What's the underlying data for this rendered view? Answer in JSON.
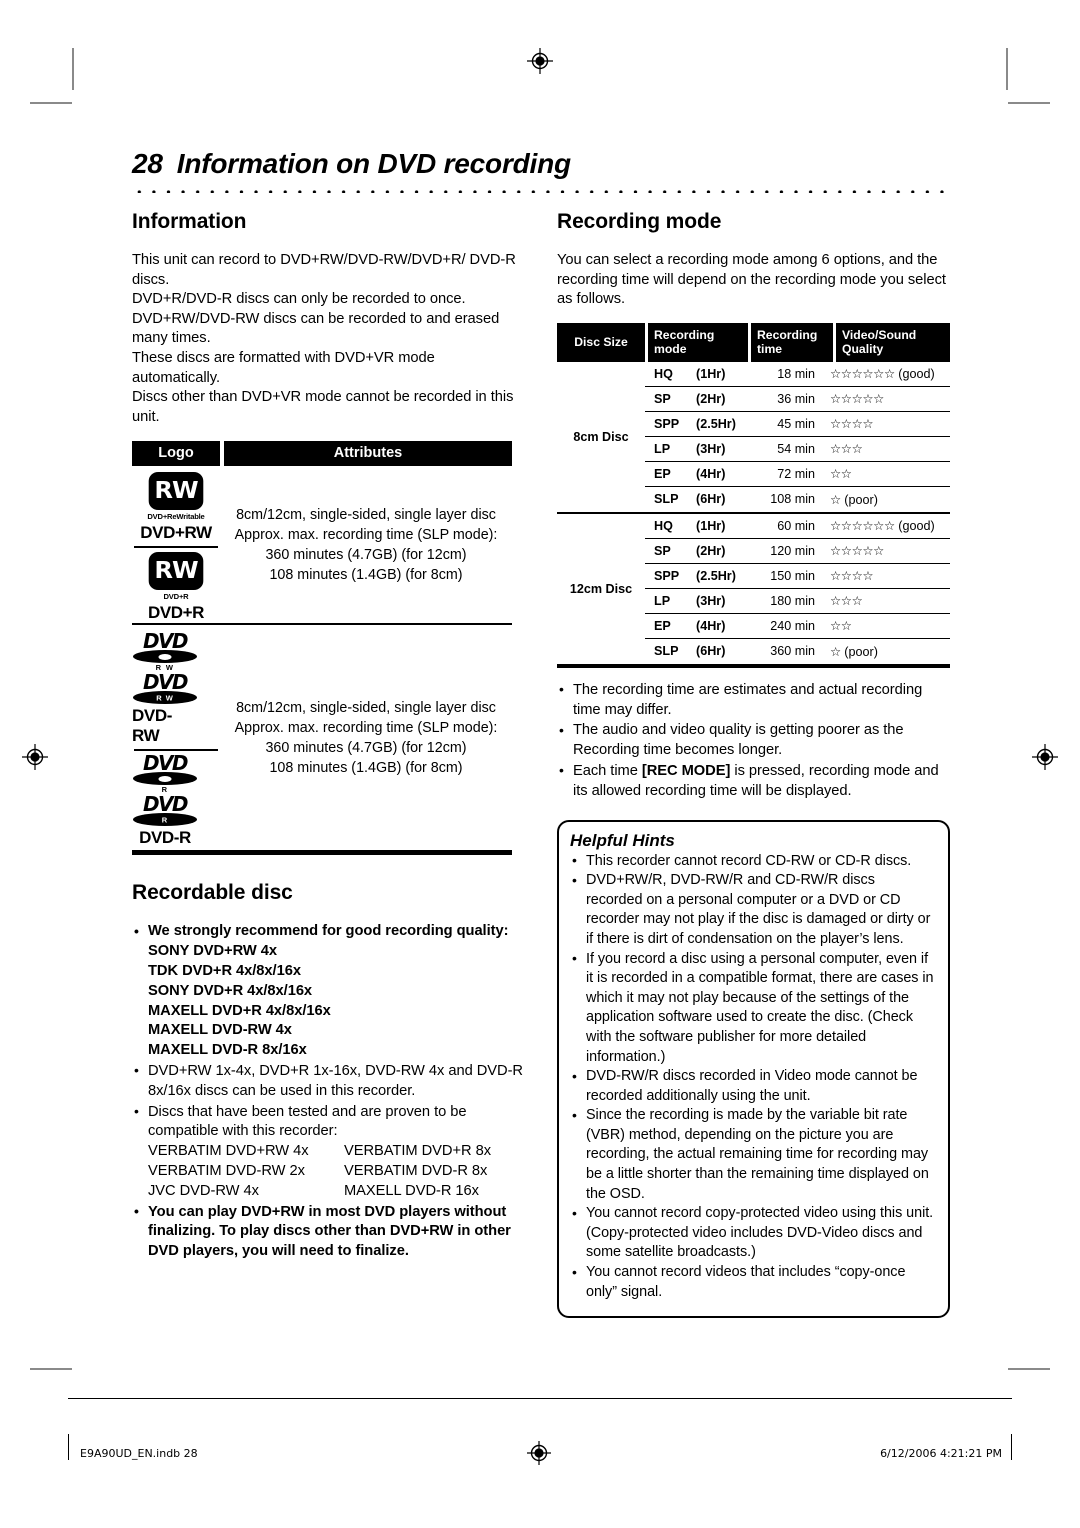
{
  "header": {
    "page_number": "28",
    "title": "Information on DVD recording"
  },
  "left_column": {
    "information": {
      "heading": "Information",
      "paragraph": "This unit can record to DVD+RW/DVD-RW/DVD+R/ DVD-R discs.\nDVD+R/DVD-R discs can only be recorded to once.\nDVD+RW/DVD-RW discs can be recorded to and erased many times.\nThese discs are formatted with DVD+VR mode automatically.\nDiscs other than DVD+VR mode cannot be recorded in this unit."
    },
    "logo_table": {
      "headers": {
        "logo": "Logo",
        "attributes": "Attributes"
      },
      "rows": [
        {
          "logos": [
            {
              "type": "rw-badge",
              "badge": "RW",
              "sub": "DVD+ReWritable",
              "name": "DVD+RW"
            },
            {
              "type": "rw-badge",
              "badge": "RW",
              "sub": "DVD+R",
              "name": "DVD+R"
            }
          ],
          "attributes": [
            "8cm/12cm, single-sided, single layer disc",
            "Approx. max. recording time (SLP mode):",
            "360 minutes (4.7GB) (for 12cm)",
            "108 minutes (1.4GB) (for 8cm)"
          ]
        },
        {
          "logos": [
            {
              "type": "dvd-hollow",
              "word": "DVD",
              "cap": "R W",
              "name": ""
            },
            {
              "type": "dvd-solid",
              "word": "DVD",
              "sub": "R W",
              "name": "DVD-RW"
            },
            {
              "type": "dvd-hollow",
              "word": "DVD",
              "cap": "R",
              "name": ""
            },
            {
              "type": "dvd-solid",
              "word": "DVD",
              "sub": "R",
              "name": "DVD-R"
            }
          ],
          "attributes": [
            "8cm/12cm, single-sided, single layer disc",
            "Approx. max. recording time (SLP mode):",
            "360 minutes (4.7GB) (for 12cm)",
            "108 minutes (1.4GB) (for 8cm)"
          ]
        }
      ]
    },
    "recordable_disc": {
      "heading": "Recordable disc",
      "bullets": [
        {
          "bold": true,
          "text": "We strongly recommend for good recording quality:",
          "sub_lines": [
            "SONY DVD+RW 4x",
            "TDK DVD+R 4x/8x/16x",
            "SONY DVD+R 4x/8x/16x",
            "MAXELL DVD+R 4x/8x/16x",
            "MAXELL DVD-RW 4x",
            "MAXELL DVD-R 8x/16x"
          ]
        },
        {
          "bold": false,
          "text": "DVD+RW 1x-4x, DVD+R 1x-16x, DVD-RW 4x and DVD-R 8x/16x discs can be used in this recorder."
        },
        {
          "bold": false,
          "text": "Discs that have been tested and are proven to be compatible with this recorder:",
          "pairs": [
            [
              "VERBATIM DVD+RW 4x",
              "VERBATIM DVD+R 8x"
            ],
            [
              "VERBATIM DVD-RW 2x",
              "VERBATIM DVD-R 8x"
            ],
            [
              "JVC DVD-RW 4x",
              "MAXELL DVD-R 16x"
            ]
          ]
        },
        {
          "bold": true,
          "text": "You can play DVD+RW in most DVD players without finalizing. To play discs other than DVD+RW in other DVD players, you will need to finalize."
        }
      ]
    }
  },
  "right_column": {
    "recording_mode": {
      "heading": "Recording mode",
      "paragraph": "You can select a recording mode among 6 options, and the recording time will depend on the recording mode you select as follows."
    },
    "notes": [
      "The recording time are estimates and actual recording time may differ.",
      "The audio and video quality is getting poorer as the Recording time becomes longer.",
      "Each time [REC MODE] is pressed, recording mode and its allowed recording time will be displayed."
    ],
    "notes_bold_token": "[REC MODE]",
    "helpful_hints": {
      "title": "Helpful Hints",
      "items": [
        "This recorder cannot record CD-RW or CD-R discs.",
        "DVD+RW/R, DVD-RW/R and CD-RW/R discs recorded on a personal computer or a DVD or CD recorder may not play if the disc is damaged or dirty or if there is dirt of condensation on the player’s lens.",
        "If you record a disc using a personal computer, even if it is recorded in a compatible format, there are cases in which it may not play because of the settings of the application software used to create the disc. (Check with the software publisher for more detailed information.)",
        "DVD-RW/R discs recorded in Video mode cannot be recorded additionally using the unit.",
        "Since the recording is made by the variable bit rate (VBR) method, depending on the picture you are recording, the actual remaining time for recording may be a little shorter than the remaining time displayed on the OSD.",
        "You cannot record copy-protected video using this unit. (Copy-protected video includes DVD-Video discs and some satellite broadcasts.)",
        "You cannot record videos that includes “copy-once only” signal."
      ]
    }
  },
  "chart_data": {
    "type": "table",
    "title": "Recording mode",
    "headers": [
      "Disc Size",
      "Recording mode",
      "Recording time",
      "Video/Sound Quality"
    ],
    "groups": [
      {
        "disc_size": "8cm Disc",
        "rows": [
          {
            "mode": "HQ",
            "hours": "(1Hr)",
            "time": "18 min",
            "stars": 6,
            "label": "(good)"
          },
          {
            "mode": "SP",
            "hours": "(2Hr)",
            "time": "36 min",
            "stars": 5,
            "label": ""
          },
          {
            "mode": "SPP",
            "hours": "(2.5Hr)",
            "time": "45 min",
            "stars": 4,
            "label": ""
          },
          {
            "mode": "LP",
            "hours": "(3Hr)",
            "time": "54 min",
            "stars": 3,
            "label": ""
          },
          {
            "mode": "EP",
            "hours": "(4Hr)",
            "time": "72 min",
            "stars": 2,
            "label": ""
          },
          {
            "mode": "SLP",
            "hours": "(6Hr)",
            "time": "108 min",
            "stars": 1,
            "label": "(poor)"
          }
        ]
      },
      {
        "disc_size": "12cm Disc",
        "rows": [
          {
            "mode": "HQ",
            "hours": "(1Hr)",
            "time": "60 min",
            "stars": 6,
            "label": "(good)"
          },
          {
            "mode": "SP",
            "hours": "(2Hr)",
            "time": "120 min",
            "stars": 5,
            "label": ""
          },
          {
            "mode": "SPP",
            "hours": "(2.5Hr)",
            "time": "150 min",
            "stars": 4,
            "label": ""
          },
          {
            "mode": "LP",
            "hours": "(3Hr)",
            "time": "180 min",
            "stars": 3,
            "label": ""
          },
          {
            "mode": "EP",
            "hours": "(4Hr)",
            "time": "240 min",
            "stars": 2,
            "label": ""
          },
          {
            "mode": "SLP",
            "hours": "(6Hr)",
            "time": "360 min",
            "stars": 1,
            "label": "(poor)"
          }
        ]
      }
    ],
    "star_glyph": "☆"
  },
  "footer": {
    "file_name": "E9A90UD_EN.indb   28",
    "timestamp": "6/12/2006   4:21:21 PM"
  }
}
